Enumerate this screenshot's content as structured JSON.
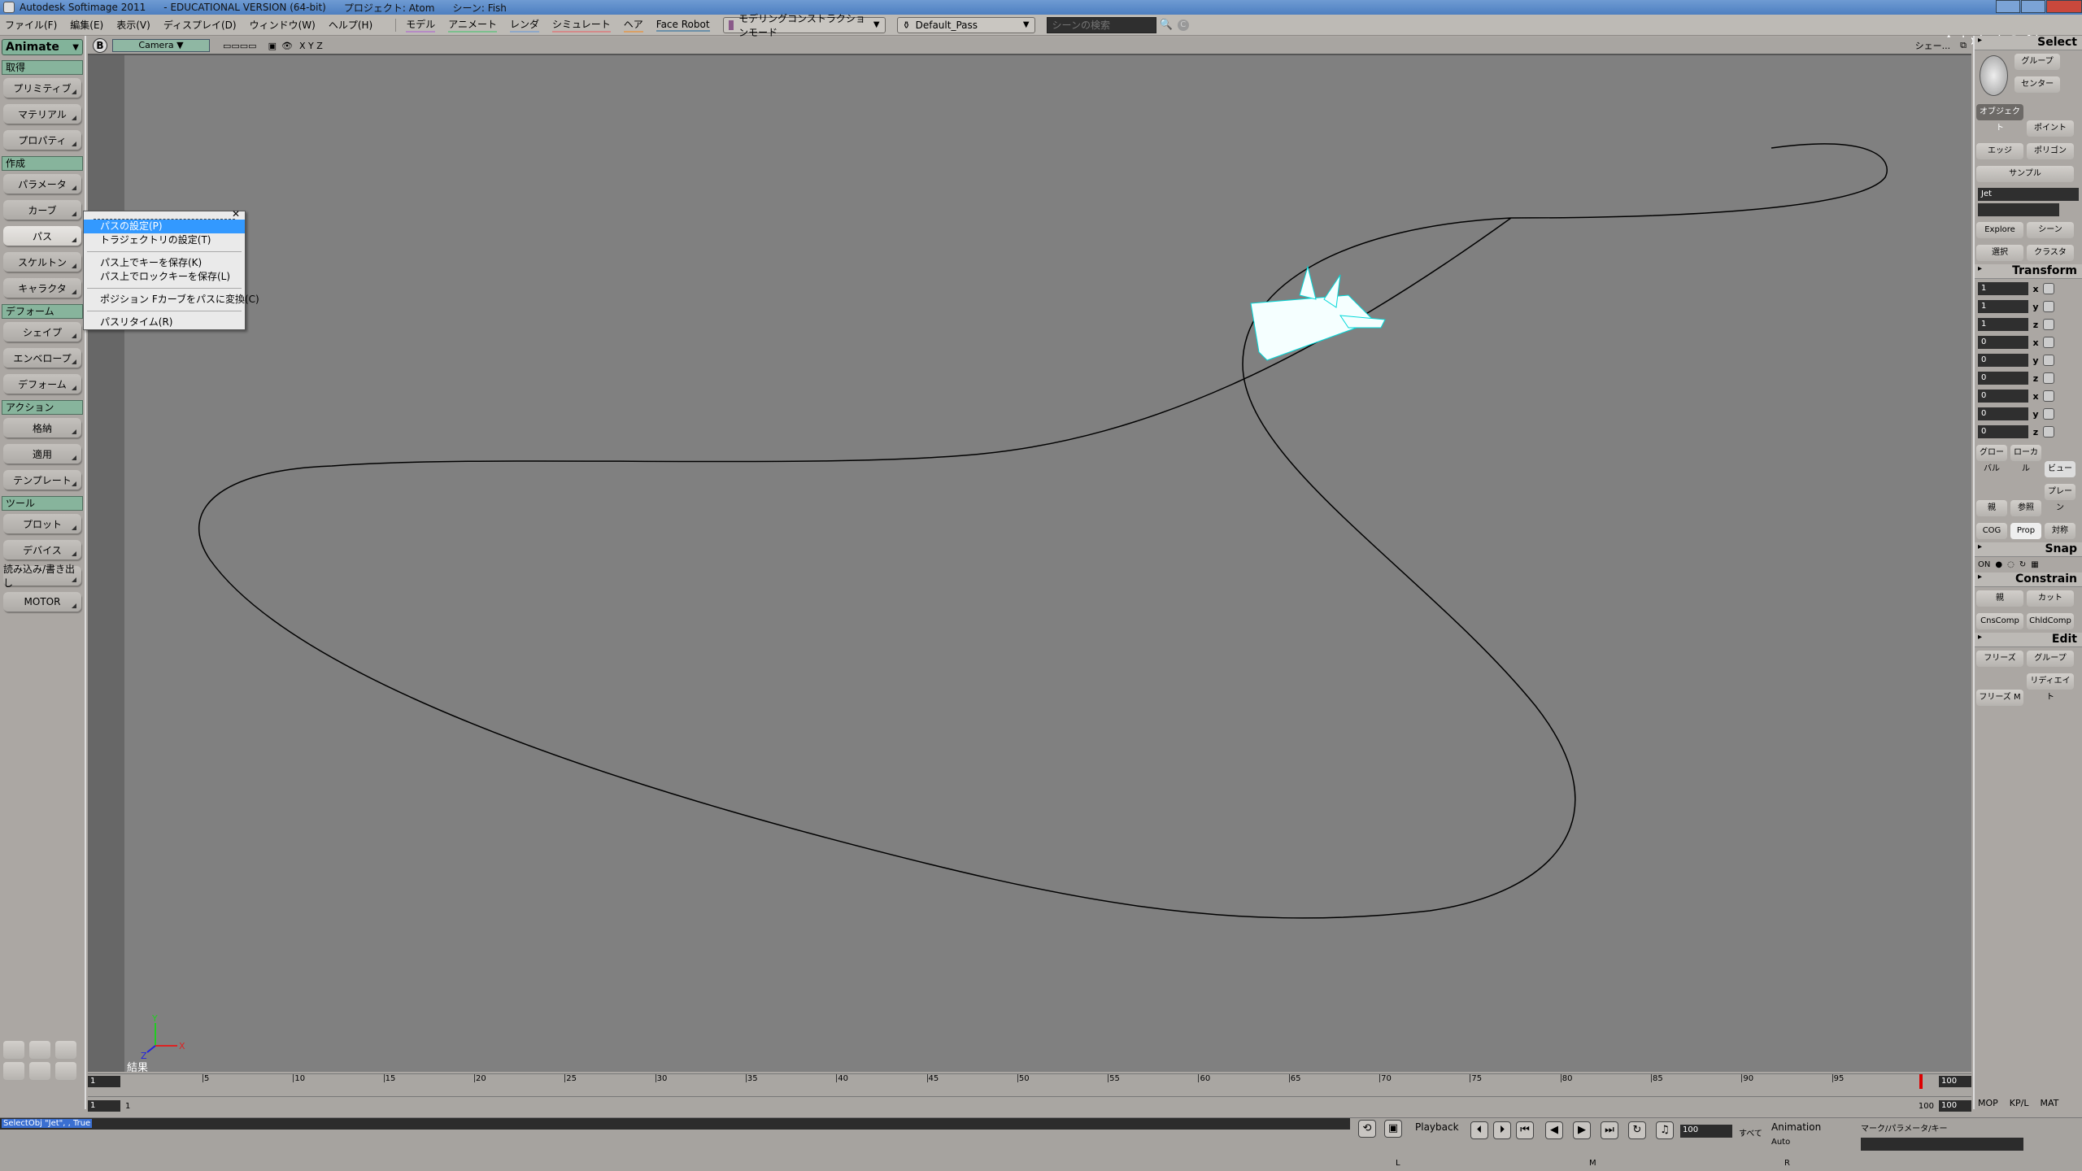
{
  "window": {
    "title": "Autodesk Softimage 2011",
    "edition": "- EDUCATIONAL VERSION (64-bit)",
    "project": "プロジェクト: Atom",
    "scene": "シーン: Fish",
    "brand": "Autodesk Softimage"
  },
  "menu": {
    "items": [
      "ファイル(F)",
      "編集(E)",
      "表示(V)",
      "ディスプレイ(D)",
      "ウィンドウ(W)",
      "ヘルプ(H)"
    ],
    "module_items": [
      "モデル",
      "アニメート",
      "レンダ",
      "シミュレート",
      "ヘア",
      "Face Robot"
    ],
    "mode_dropdown": "モデリングコンストラクションモード",
    "pass_dropdown": "Default_Pass",
    "search_placeholder": "シーンの検索"
  },
  "left_panel": {
    "mode": "Animate",
    "sections": [
      {
        "label": "取得",
        "buttons": [
          "プリミティブ",
          "マテリアル",
          "プロパティ"
        ]
      },
      {
        "label": "作成",
        "buttons": [
          "パラメータ",
          "カーブ",
          "パス",
          "スケルトン",
          "キャラクタ"
        ]
      },
      {
        "label": "デフォーム",
        "buttons": [
          "シェイプ",
          "エンベロープ",
          "デフォーム"
        ]
      },
      {
        "label": "アクション",
        "buttons": [
          "格納",
          "適用",
          "テンプレート"
        ]
      },
      {
        "label": "ツール",
        "buttons": [
          "プロット",
          "デバイス",
          "読み込み/書き出し",
          "MOTOR"
        ]
      }
    ],
    "active_button": "パス"
  },
  "viewport": {
    "camera": "Camera",
    "axes_label": "X Y Z",
    "shading": "シェー...",
    "result_label": "結果",
    "axis_x": "X",
    "axis_y": "Y",
    "axis_z": "Z"
  },
  "popup_menu": {
    "items": [
      {
        "label": "パスの設定(P)",
        "highlighted": true
      },
      {
        "label": "トラジェクトリの設定(T)"
      },
      {
        "separator": true
      },
      {
        "label": "パス上でキーを保存(K)"
      },
      {
        "label": "パス上でロックキーを保存(L)"
      },
      {
        "separator": true
      },
      {
        "label": "ポジション Fカーブをパスに変換(C)"
      },
      {
        "separator": true
      },
      {
        "label": "パスリタイム(R)"
      }
    ]
  },
  "right_panel": {
    "select": {
      "header": "Select",
      "buttons": [
        "グループ",
        "センター",
        "オブジェクト",
        "ポイント",
        "エッジ",
        "ポリゴン",
        "サンプル"
      ],
      "object_name": "Jet",
      "explore": "Explore",
      "scene_btn": "シーン",
      "select_btn": "選択",
      "cluster_btn": "クラスタ"
    },
    "transform": {
      "header": "Transform",
      "scale": [
        "1",
        "1",
        "1"
      ],
      "rotate": [
        "0",
        "0",
        "0"
      ],
      "translate": [
        "0",
        "0",
        "0"
      ],
      "axes": [
        "x",
        "y",
        "z"
      ],
      "mode_buttons": [
        "グローバル",
        "ローカル",
        "ビュー"
      ],
      "ref_buttons": [
        "親",
        "参照",
        "プレーン"
      ],
      "extra_buttons": [
        "COG",
        "Prop",
        "対称"
      ]
    },
    "snap": {
      "header": "Snap",
      "on_label": "ON"
    },
    "constrain": {
      "header": "Constrain",
      "buttons": [
        "親",
        "カット",
        "CnsComp",
        "ChldComp"
      ]
    },
    "edit": {
      "header": "Edit",
      "buttons": [
        "フリーズ",
        "グループ",
        "フリーズ M",
        "リディエイト"
      ]
    }
  },
  "timeline": {
    "start_frame": "1",
    "end_frame": "100",
    "current_frame": "100",
    "ticks": [
      "5",
      "10",
      "15",
      "20",
      "25",
      "30",
      "35",
      "40",
      "45",
      "50",
      "55",
      "60",
      "65",
      "70",
      "75",
      "80",
      "85",
      "90",
      "95"
    ],
    "range_start": "1",
    "range_end": "100",
    "range_end2": "100",
    "range_start2": "1",
    "tabs": [
      "MOP",
      "KP/L",
      "MAT"
    ]
  },
  "status": {
    "command": "SelectObj \"Jet\", , True",
    "playback_label": "Playback",
    "frame_field": "100",
    "all_label": "すべて",
    "animation_label": "Animation",
    "auto_label": "Auto",
    "marker_label": "マーク/パラメータ/キー",
    "mouse_l": "L",
    "mouse_m": "M",
    "mouse_r": "R"
  }
}
